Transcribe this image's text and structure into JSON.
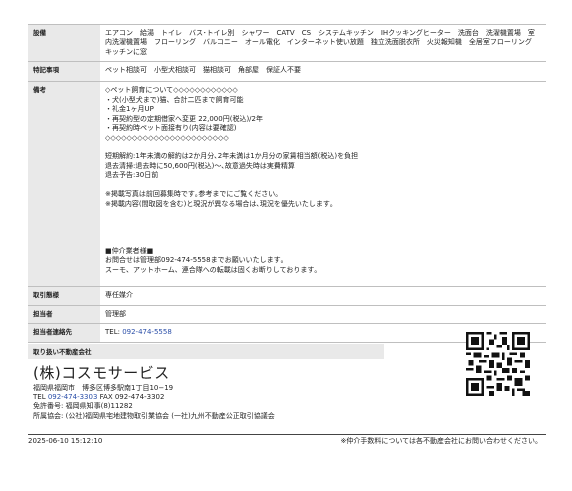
{
  "table": {
    "equipment": {
      "label": "設備",
      "value": "エアコン　給湯　トイレ　バス･トイレ別　シャワー　CATV　CS　システムキッチン　IHクッキングヒーター　洗面台　洗濯機置場　室内洗濯機置場　フローリング　バルコニー　オール電化　インターネット使い放題　独立洗面脱衣所　火災報知機　全居室フローリング　キッチンに窓"
    },
    "features": {
      "label": "特記事項",
      "value": "ペット相談可　小型犬相談可　猫相談可　角部屋　保証人不要"
    },
    "notes": {
      "label": "備考",
      "value": "◇ペット飼育について◇◇◇◇◇◇◇◇◇◇◇◇\n・犬(小型犬まで)猫、合計二匹まで飼育可能\n・礼金1ヶ月UP\n・再契約型の定期借家へ変更 22,000円(税込)/2年\n・再契約時ペット面接有り(内容は要確認)\n◇◇◇◇◇◇◇◇◇◇◇◇◇◇◇◇◇◇◇◇◇◇◇\n\n短期解約:1年未満の解約は2か月分､2年未満は1か月分の家賃相当額(税込)を負担\n退去清掃:退去時に50,600円(税込)〜､故意過失時は実費精算\n退去予告:30日前\n\n※掲載写真は前回募集時です｡参考までにご覧ください｡\n※掲載内容(間取図を含む)と現況が異なる場合は､現況を優先いたします｡\n\n\n\n\n■仲介業者様■\nお問合せは管理部092-474-5558までお願いいたします｡\nスーモ、アットホーム、連合隊への転載は固くお断りしております｡"
    },
    "transaction": {
      "label": "取引態様",
      "value": "専任媒介"
    },
    "contact_person": {
      "label": "担当者",
      "value": "管理部"
    },
    "contact_phone": {
      "label": "担当者連絡先",
      "prefix": "TEL: ",
      "phone": "092-474-5558"
    }
  },
  "company": {
    "header": "取り扱い不動産会社",
    "name": "(株)コスモサービス",
    "address": "福岡県福岡市　博多区博多駅南1丁目10−19",
    "tel_label": "TEL ",
    "tel": "092-474-3303",
    "fax": " FAX 092-474-3302",
    "license": "免許番号: 福岡県知事(8)11282",
    "association": "所属協会: (公社)福岡県宅地建物取引業協会 (一社)九州不動産公正取引協議会"
  },
  "qr_code": {
    "icon": "qr-code-icon"
  },
  "footer": {
    "timestamp": "2025-06-10 15:12:10",
    "note": "※仲介手数料については各不動産会社にお問い合わせください。"
  },
  "colors": {
    "label_bg": "#e9e9e9",
    "link": "#2a4ea8",
    "border": "#bfbfbf"
  }
}
